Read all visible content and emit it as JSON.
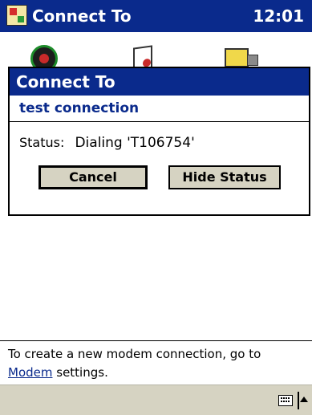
{
  "app": {
    "title": "Connect To",
    "time": "12:01"
  },
  "dialog": {
    "title": "Connect To",
    "connection_name": "test connection",
    "status_label": "Status:",
    "status_value": "Dialing 'T106754'",
    "buttons": {
      "cancel": "Cancel",
      "hide": "Hide Status"
    }
  },
  "info": {
    "line1": "To create a new modem connection, go to",
    "link": "Modem",
    "line2_rest": " settings."
  },
  "icons": {
    "app": "windows-flag-icon",
    "background": [
      "connection-icon",
      "document-icon",
      "phone-modem-icon"
    ],
    "taskbar": [
      "keyboard-icon",
      "input-menu-arrow-icon"
    ]
  }
}
